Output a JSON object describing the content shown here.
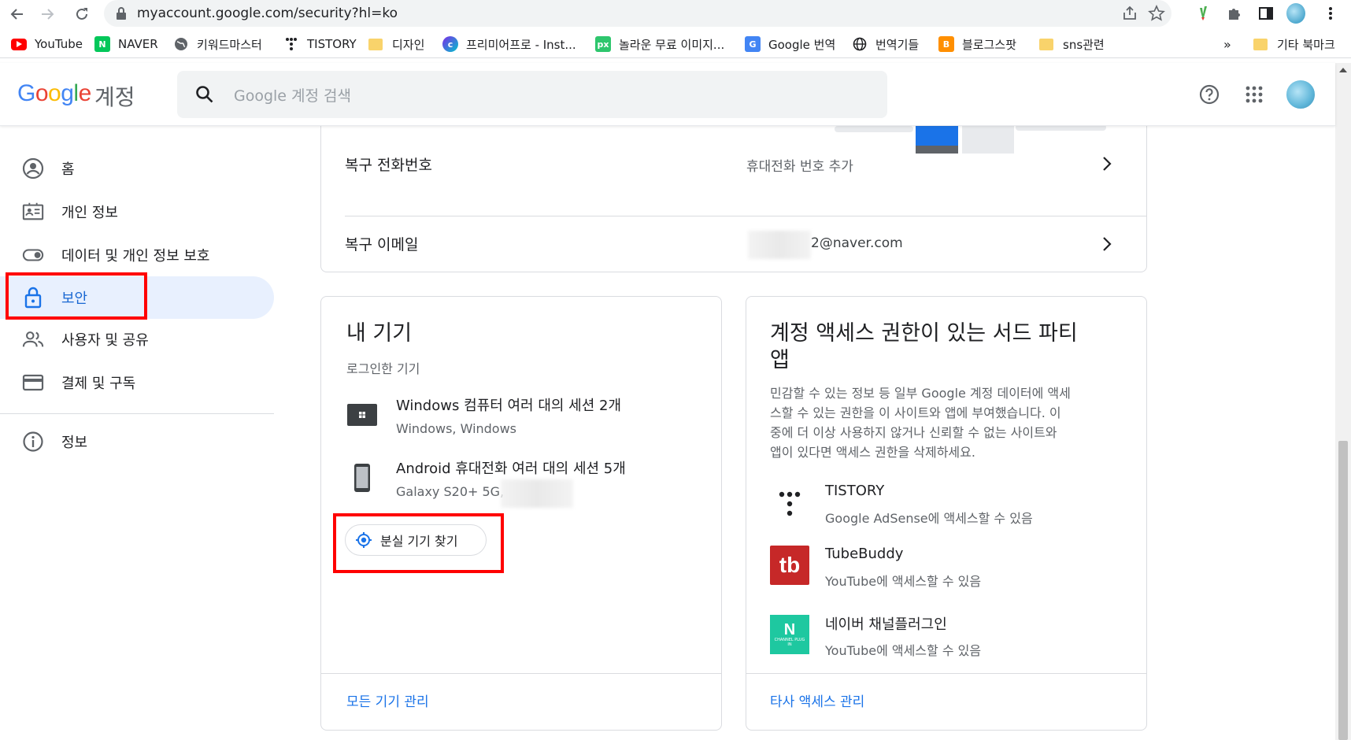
{
  "browser": {
    "url": "myaccount.google.com/security?hl=ko",
    "bookmarks": [
      {
        "label": "YouTube"
      },
      {
        "label": "NAVER"
      },
      {
        "label": "키워드마스터"
      },
      {
        "label": "TISTORY"
      },
      {
        "label": "디자인"
      },
      {
        "label": "프리미어프로 - Inst..."
      },
      {
        "label": "놀라운 무료 이미지..."
      },
      {
        "label": "Google 번역"
      },
      {
        "label": "번역기들"
      },
      {
        "label": "블로그스팟"
      },
      {
        "label": "sns관련"
      }
    ],
    "overflow": "»",
    "other_bookmarks": "기타 북마크"
  },
  "header": {
    "logo": "Google",
    "title": "계정",
    "search_placeholder": "Google 계정 검색"
  },
  "sidebar": {
    "items": [
      {
        "label": "홈",
        "icon": "account-circle-icon"
      },
      {
        "label": "개인 정보",
        "icon": "id-card-icon"
      },
      {
        "label": "데이터 및 개인 정보 보호",
        "icon": "toggle-icon"
      },
      {
        "label": "보안",
        "icon": "lock-icon",
        "active": true
      },
      {
        "label": "사용자 및 공유",
        "icon": "people-icon"
      },
      {
        "label": "결제 및 구독",
        "icon": "credit-card-icon"
      },
      {
        "label": "정보",
        "icon": "info-icon"
      }
    ]
  },
  "recovery": {
    "phone_label": "복구 전화번호",
    "phone_value": "휴대전화 번호 추가",
    "email_label": "복구 이메일",
    "email_value": "2@naver.com"
  },
  "devices": {
    "title": "내 기기",
    "subtitle": "로그인한 기기",
    "items": [
      {
        "title": "Windows 컴퓨터 여러 대의 세션 2개",
        "sub": "Windows, Windows",
        "icon": "laptop-icon"
      },
      {
        "title": "Android 휴대전화 여러 대의 세션 5개",
        "sub": "Galaxy S20+ 5G, 5",
        "icon": "phone-icon"
      }
    ],
    "find_button": "분실 기기 찾기",
    "manage_link": "모든 기기 관리"
  },
  "third_party": {
    "title_line1": "계정 액세스 권한이 있는 서드 파티",
    "title_line2": "앱",
    "description_lines": [
      "민감할 수 있는 정보 등 일부 Google 계정 데이터에 액세",
      "스할 수 있는 권한을 이 사이트와 앱에 부여했습니다. 이",
      "중에 더 이상 사용하지 않거나 신뢰할 수 없는 사이트와",
      "앱이 있다면 액세스 권한을 삭제하세요."
    ],
    "apps": [
      {
        "name": "TISTORY",
        "access": "Google AdSense에 액세스할 수 있음",
        "icon": "tistory-logo"
      },
      {
        "name": "TubeBuddy",
        "access": "YouTube에 액세스할 수 있음",
        "icon": "tubebuddy-logo",
        "logo_text": "tb",
        "color": "#d32f2f"
      },
      {
        "name": "네이버 채널플러그인",
        "access": "YouTube에 액세스할 수 있음",
        "icon": "naver-channel-plugin-logo",
        "logo_text": "N",
        "logo_sub": "CHANNEL PLUG IN",
        "color": "#1ec8a0"
      }
    ],
    "manage_link": "타사 액세스 관리"
  }
}
